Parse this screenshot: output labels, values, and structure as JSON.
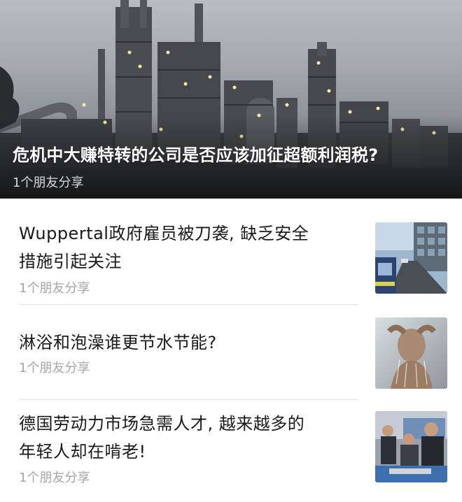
{
  "hero": {
    "title": "危机中大赚特转的公司是否应该加征超额利润税?",
    "meta": "1个朋友分享"
  },
  "items": [
    {
      "title_line1": "Wuppertal政府雇员被刀袭, 缺乏安全",
      "title_line2": "措施引起关注",
      "meta": "1个朋友分享"
    },
    {
      "title_line1": "淋浴和泡澡谁更节水节能?",
      "meta": "1个朋友分享"
    },
    {
      "title_line1": "德国劳动力市场急需人才, 越来越多的",
      "title_line2": "年轻人却在啃老!",
      "meta": "1个朋友分享"
    }
  ]
}
